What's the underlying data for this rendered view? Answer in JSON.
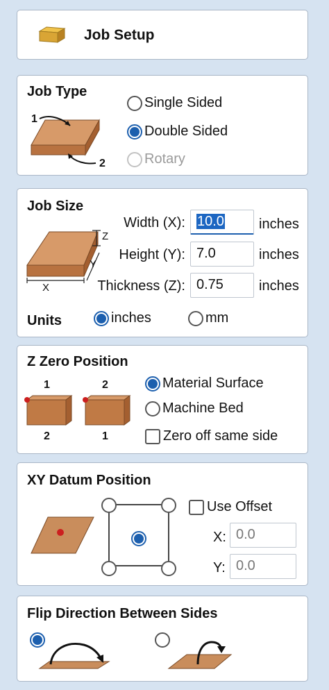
{
  "header": {
    "title": "Job Setup",
    "icon": "material-block-icon"
  },
  "job_type": {
    "title": "Job Type",
    "options": [
      {
        "label": "Single Sided",
        "state": "unchecked"
      },
      {
        "label": "Double Sided",
        "state": "checked"
      },
      {
        "label": "Rotary",
        "state": "disabled"
      }
    ],
    "diagram_labels": {
      "side_top": "1",
      "side_bottom": "2"
    }
  },
  "job_size": {
    "title": "Job Size",
    "width_label": "Width (X):",
    "width_value": "10.0",
    "height_label": "Height (Y):",
    "height_value": "7.0",
    "thickness_label": "Thickness (Z):",
    "thickness_value": "0.75",
    "unit_text": "inches",
    "diagram_labels": {
      "x": "X",
      "y": "Y",
      "z": "Z"
    },
    "units_label": "Units",
    "units_options": [
      {
        "label": "inches",
        "state": "checked"
      },
      {
        "label": "mm",
        "state": "unchecked"
      }
    ]
  },
  "z_zero": {
    "title": "Z Zero Position",
    "block_left": {
      "top": "1",
      "bottom": "2"
    },
    "block_right": {
      "top": "2",
      "bottom": "1"
    },
    "options": [
      {
        "label": "Material Surface",
        "state": "checked"
      },
      {
        "label": "Machine Bed",
        "state": "unchecked"
      }
    ],
    "zero_off_same_side_label": "Zero off same side",
    "zero_off_same_side_checked": false
  },
  "xy_datum": {
    "title": "XY Datum Position",
    "selected": "center",
    "use_offset_label": "Use Offset",
    "use_offset_checked": false,
    "x_label": "X:",
    "x_value": "0.0",
    "y_label": "Y:",
    "y_value": "0.0"
  },
  "flip": {
    "title": "Flip Direction Between Sides",
    "options": [
      {
        "name": "flip-horizontal",
        "state": "checked"
      },
      {
        "name": "flip-vertical",
        "state": "unchecked"
      }
    ]
  },
  "colors": {
    "background": "#d6e3f1",
    "accent": "#1c5fae",
    "wood": "#c98d5c",
    "marker": "#cc1f1f"
  }
}
